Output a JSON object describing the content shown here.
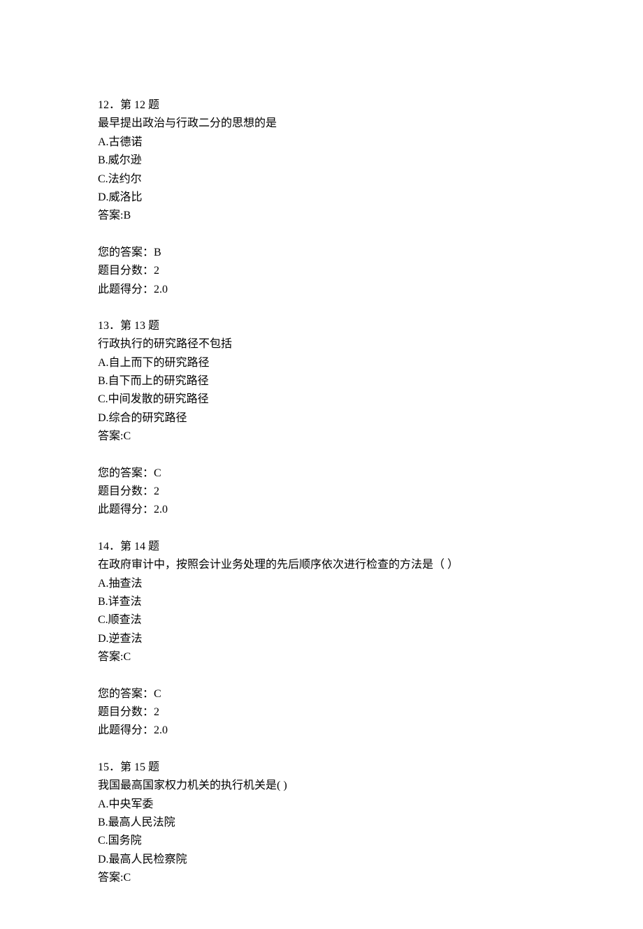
{
  "questions": [
    {
      "number_line": "12．第 12 题",
      "stem": "最早提出政治与行政二分的思想的是",
      "options": [
        "A.古德诺",
        "B.威尔逊",
        "C.法约尔",
        "D.威洛比"
      ],
      "answer_line": "答案:B",
      "your_answer": "您的答案：B",
      "full_score": "题目分数：2",
      "earned_score": "此题得分：2.0"
    },
    {
      "number_line": "13．第 13 题",
      "stem": "行政执行的研究路径不包括",
      "options": [
        "A.自上而下的研究路径",
        "B.自下而上的研究路径",
        "C.中间发散的研究路径",
        "D.综合的研究路径"
      ],
      "answer_line": "答案:C",
      "your_answer": "您的答案：C",
      "full_score": "题目分数：2",
      "earned_score": "此题得分：2.0"
    },
    {
      "number_line": "14．第 14 题",
      "stem": "在政府审计中，按照会计业务处理的先后顺序依次进行检查的方法是（ ）",
      "options": [
        "A.抽查法",
        "B.详查法",
        "C.顺查法",
        "D.逆查法"
      ],
      "answer_line": "答案:C",
      "your_answer": "您的答案：C",
      "full_score": "题目分数：2",
      "earned_score": "此题得分：2.0"
    },
    {
      "number_line": "15．第 15 题",
      "stem": "我国最高国家权力机关的执行机关是( )",
      "options": [
        "A.中央军委",
        "B.最高人民法院",
        "C.国务院",
        "D.最高人民检察院"
      ],
      "answer_line": "答案:C",
      "your_answer": null,
      "full_score": null,
      "earned_score": null
    }
  ]
}
